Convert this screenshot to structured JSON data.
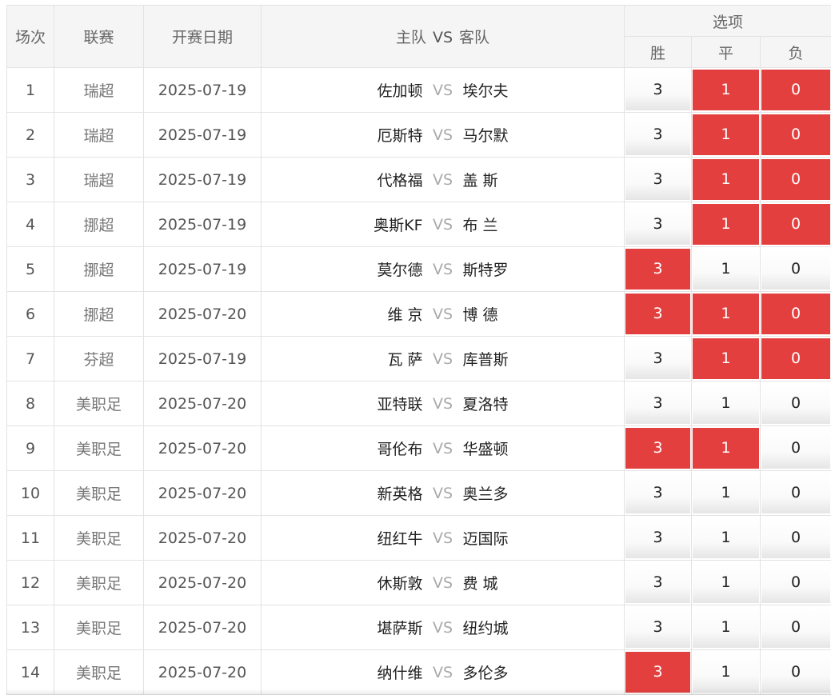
{
  "header": {
    "index": "场次",
    "league": "联赛",
    "date": "开赛日期",
    "home": "主队",
    "vs": "VS",
    "away": "客队",
    "options": "选项",
    "win": "胜",
    "draw": "平",
    "lose": "负"
  },
  "option_values": [
    "3",
    "1",
    "0"
  ],
  "colors": {
    "selected": "#e43f3f",
    "border": "#e3e3e3",
    "header_bg": "#f5f5f5"
  },
  "rows": [
    {
      "index": "1",
      "league": "瑞超",
      "date": "2025-07-19",
      "home": "佐加顿",
      "away": "埃尔夫",
      "selected": [
        false,
        true,
        true
      ]
    },
    {
      "index": "2",
      "league": "瑞超",
      "date": "2025-07-19",
      "home": "厄斯特",
      "away": "马尔默",
      "selected": [
        false,
        true,
        true
      ]
    },
    {
      "index": "3",
      "league": "瑞超",
      "date": "2025-07-19",
      "home": "代格福",
      "away": "盖 斯",
      "selected": [
        false,
        true,
        true
      ]
    },
    {
      "index": "4",
      "league": "挪超",
      "date": "2025-07-19",
      "home": "奥斯KF",
      "away": "布 兰",
      "selected": [
        false,
        true,
        true
      ]
    },
    {
      "index": "5",
      "league": "挪超",
      "date": "2025-07-19",
      "home": "莫尔德",
      "away": "斯特罗",
      "selected": [
        true,
        false,
        false
      ]
    },
    {
      "index": "6",
      "league": "挪超",
      "date": "2025-07-20",
      "home": "维 京",
      "away": "博 德",
      "selected": [
        true,
        true,
        true
      ]
    },
    {
      "index": "7",
      "league": "芬超",
      "date": "2025-07-19",
      "home": "瓦 萨",
      "away": "库普斯",
      "selected": [
        false,
        true,
        true
      ]
    },
    {
      "index": "8",
      "league": "美职足",
      "date": "2025-07-20",
      "home": "亚特联",
      "away": "夏洛特",
      "selected": [
        false,
        false,
        false
      ]
    },
    {
      "index": "9",
      "league": "美职足",
      "date": "2025-07-20",
      "home": "哥伦布",
      "away": "华盛顿",
      "selected": [
        true,
        true,
        false
      ]
    },
    {
      "index": "10",
      "league": "美职足",
      "date": "2025-07-20",
      "home": "新英格",
      "away": "奥兰多",
      "selected": [
        false,
        false,
        false
      ]
    },
    {
      "index": "11",
      "league": "美职足",
      "date": "2025-07-20",
      "home": "纽红牛",
      "away": "迈国际",
      "selected": [
        false,
        false,
        false
      ]
    },
    {
      "index": "12",
      "league": "美职足",
      "date": "2025-07-20",
      "home": "休斯敦",
      "away": "费 城",
      "selected": [
        false,
        false,
        false
      ]
    },
    {
      "index": "13",
      "league": "美职足",
      "date": "2025-07-20",
      "home": "堪萨斯",
      "away": "纽约城",
      "selected": [
        false,
        false,
        false
      ]
    },
    {
      "index": "14",
      "league": "美职足",
      "date": "2025-07-20",
      "home": "纳什维",
      "away": "多伦多",
      "selected": [
        true,
        false,
        false
      ]
    }
  ]
}
